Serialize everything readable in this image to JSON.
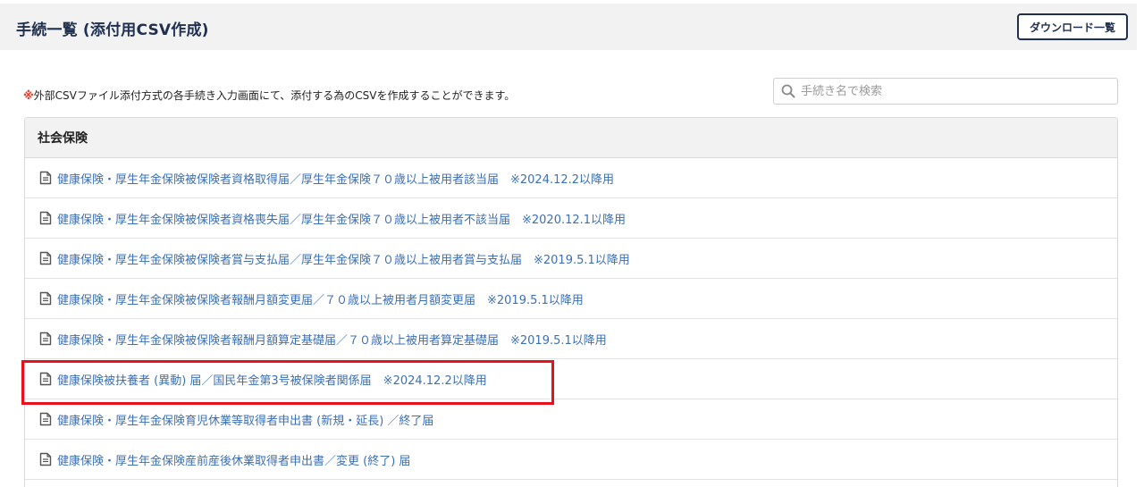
{
  "header": {
    "title": "手続一覧 (添付用CSV作成)",
    "download_label": "ダウンロード一覧"
  },
  "notice": {
    "mark": "※",
    "text": "外部CSVファイル添付方式の各手続き入力画面にて、添付する為のCSVを作成することができます。"
  },
  "search": {
    "placeholder": "手続き名で検索",
    "value": ""
  },
  "section": {
    "title": "社会保険",
    "items": [
      {
        "label": "健康保険・厚生年金保険被保険者資格取得届／厚生年金保険７０歳以上被用者該当届　※2024.12.2以降用"
      },
      {
        "label": "健康保険・厚生年金保険被保険者資格喪失届／厚生年金保険７０歳以上被用者不該当届　※2020.12.1以降用"
      },
      {
        "label": "健康保険・厚生年金保険被保険者賞与支払届／厚生年金保険７０歳以上被用者賞与支払届　※2019.5.1以降用"
      },
      {
        "label": "健康保険・厚生年金保険被保険者報酬月額変更届／７０歳以上被用者月額変更届　※2019.5.1以降用"
      },
      {
        "label": "健康保険・厚生年金保険被保険者報酬月額算定基礎届／７０歳以上被用者算定基礎届　※2019.5.1以降用"
      },
      {
        "label": "健康保険被扶養者 (異動) 届／国民年金第3号被保険者関係届　※2024.12.2以降用"
      },
      {
        "label": "健康保険・厚生年金保険育児休業等取得者申出書 (新規・延長) ／終了届"
      },
      {
        "label": "健康保険・厚生年金保険産前産後休業取得者申出書／変更 (終了) 届"
      }
    ]
  },
  "colors": {
    "link": "#3b6fb6",
    "title": "#1f2f4f",
    "notice_mark": "#e23a2b",
    "highlight": "#e8111b"
  },
  "icons": {
    "search": "search-icon",
    "item": "document-icon"
  }
}
